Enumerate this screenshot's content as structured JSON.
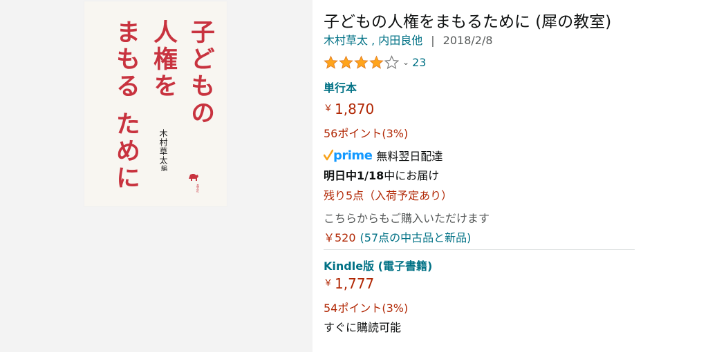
{
  "cover": {
    "title_lines": [
      "子どもの",
      "人権を",
      "まもる ために"
    ],
    "author": "木村草太",
    "author_suffix": "編",
    "publisher_text": "晶文社"
  },
  "product": {
    "title": "子どもの人権をまもるために (犀の教室)",
    "authors": "木村草太 , 内田良他",
    "separator": "|",
    "date": "2018/2/8",
    "rating": {
      "stars": 4.0,
      "max": 5,
      "count": "23"
    }
  },
  "formats": [
    {
      "name": "単行本",
      "price": "1,870",
      "points": "56ポイント(3%)",
      "prime_label": "prime",
      "prime_text": "無料翌日配達",
      "delivery_bold": "明日中1/18",
      "delivery_rest": "中にお届け",
      "stock": "残り5点（入荷予定あり）",
      "other_sellers": "こちらからもご購入いただけます",
      "used_price": "￥520",
      "used_count": "(57点の中古品と新品)"
    },
    {
      "name": "Kindle版 (電子書籍)",
      "price": "1,777",
      "points": "54ポイント(3%)",
      "availability": "すぐに購読可能"
    }
  ],
  "currency_symbol": "￥",
  "colors": {
    "link": "#007185",
    "price": "#b12704",
    "star": "#ffa41c",
    "prime": "#1399ff",
    "cover_text": "#c8333f"
  }
}
